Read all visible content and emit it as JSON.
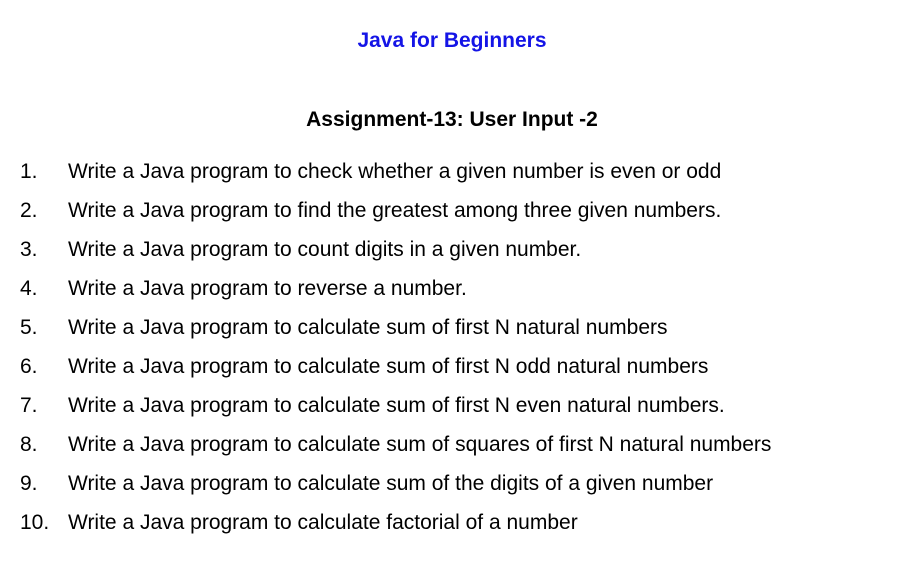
{
  "document": {
    "title": "Java for Beginners",
    "subtitle": "Assignment-13: User Input -2",
    "title_color": "#1414e6",
    "tasks": [
      {
        "number": "1.",
        "text": "Write a Java program to check whether a given number is even or odd"
      },
      {
        "number": "2.",
        "text": "Write a Java program to find the greatest among three given numbers."
      },
      {
        "number": "3.",
        "text": "Write a Java program to count digits in a given number."
      },
      {
        "number": "4.",
        "text": "Write a Java program to reverse a number."
      },
      {
        "number": "5.",
        "text": "Write a Java program to calculate sum of first N natural numbers"
      },
      {
        "number": "6.",
        "text": "Write a Java program to calculate sum of first N odd natural numbers"
      },
      {
        "number": "7.",
        "text": "Write a Java program to calculate sum of first N even natural numbers."
      },
      {
        "number": "8.",
        "text": "Write a Java program to calculate sum of squares of first N natural numbers"
      },
      {
        "number": "9.",
        "text": "Write a Java program to calculate sum of the digits of a given number"
      },
      {
        "number": "10.",
        "text": "Write a Java program to calculate factorial of a number"
      }
    ]
  }
}
